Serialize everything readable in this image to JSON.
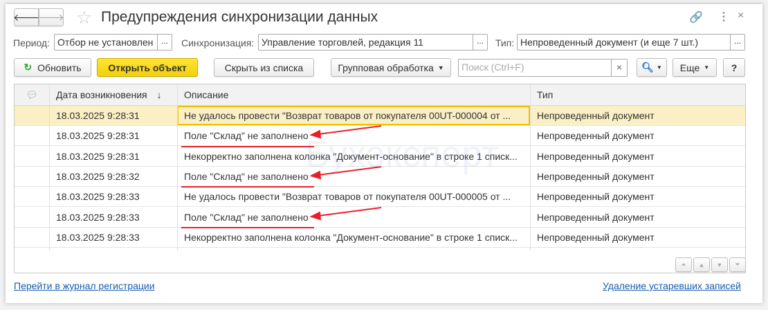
{
  "title": "Предупреждения синхронизации данных",
  "filters": {
    "period_label": "Период:",
    "period_value": "Отбор не установлен",
    "sync_label": "Синхронизация:",
    "sync_value": "Управление торговлей, редакция 11",
    "type_label": "Тип:",
    "type_value": "Непроведенный документ (и еще 7 шт.)",
    "dots": "..."
  },
  "toolbar": {
    "refresh": "Обновить",
    "open": "Открыть объект",
    "hide": "Скрыть из списка",
    "group": "Групповая обработка",
    "search_placeholder": "Поиск (Ctrl+F)",
    "more": "Еще",
    "help": "?",
    "clear": "×"
  },
  "table": {
    "headers": {
      "date": "Дата возникновения",
      "desc": "Описание",
      "type": "Тип"
    },
    "rows": [
      {
        "date": "18.03.2025 9:28:31",
        "desc": "Не удалось провести \"Возврат товаров от покупателя 00UT-000004 от ...",
        "type": "Непроведенный документ"
      },
      {
        "date": "18.03.2025 9:28:31",
        "desc": "Поле \"Склад\" не заполнено",
        "type": "Непроведенный документ"
      },
      {
        "date": "18.03.2025 9:28:31",
        "desc": "Некорректно заполнена колонка \"Документ-основание\" в строке 1 списк...",
        "type": "Непроведенный документ"
      },
      {
        "date": "18.03.2025 9:28:32",
        "desc": "Поле \"Склад\" не заполнено",
        "type": "Непроведенный документ"
      },
      {
        "date": "18.03.2025 9:28:33",
        "desc": "Не удалось провести \"Возврат товаров от покупателя 00UT-000005 от ...",
        "type": "Непроведенный документ"
      },
      {
        "date": "18.03.2025 9:28:33",
        "desc": "Поле \"Склад\" не заполнено",
        "type": "Непроведенный документ"
      },
      {
        "date": "18.03.2025 9:28:33",
        "desc": "Некорректно заполнена колонка \"Документ-основание\" в строке 1 списк...",
        "type": "Непроведенный документ"
      }
    ]
  },
  "footer": {
    "journal_link": "Перейти в журнал регистрации",
    "cleanup_link": "Удаление устаревших записей"
  },
  "watermark": "Бухэксперт",
  "colors": {
    "accent_yellow": "#f5d60f",
    "selected_row": "#faefc5",
    "annotation": "#e8202a",
    "link": "#1a5bb0"
  }
}
